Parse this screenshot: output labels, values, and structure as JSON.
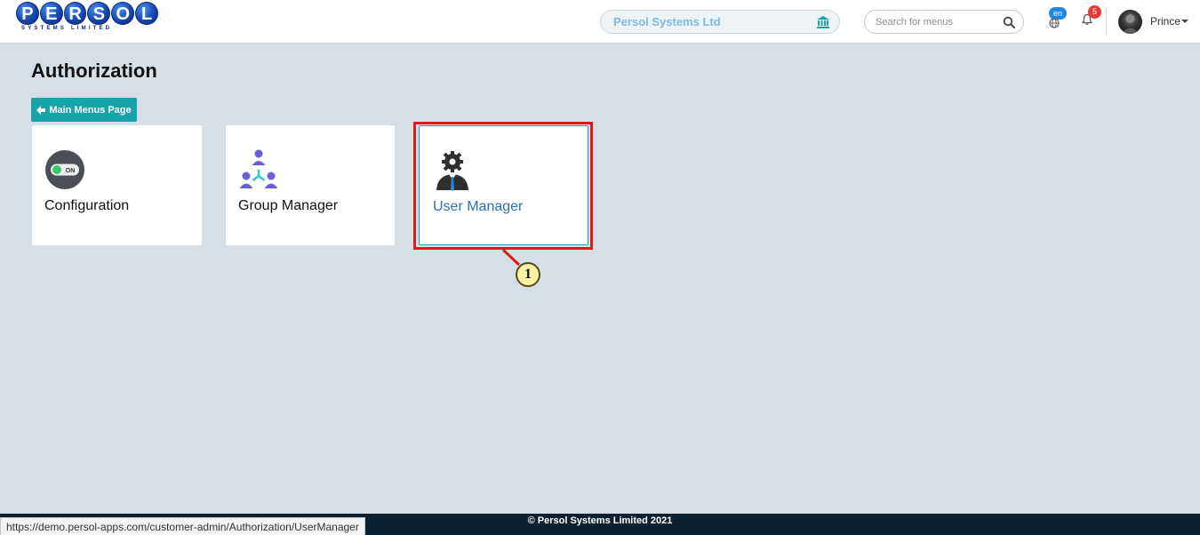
{
  "header": {
    "logo_letters": [
      "P",
      "E",
      "R",
      "S",
      "O",
      "L"
    ],
    "logo_subtitle": "SYSTEMS LIMITED",
    "company_name": "Persol Systems Ltd",
    "search_placeholder": "Search for menus",
    "language_badge": "en",
    "notification_count": "5",
    "user_name": "Prince"
  },
  "main": {
    "page_title": "Authorization",
    "back_button_label": "Main Menus Page",
    "cards": [
      {
        "label": "Configuration",
        "icon": "toggle-on-icon",
        "toggle_text": "ON"
      },
      {
        "label": "Group Manager",
        "icon": "group-hierarchy-icon"
      },
      {
        "label": "User Manager",
        "icon": "user-gear-icon"
      }
    ]
  },
  "annotation": {
    "marker_label": "1"
  },
  "footer": {
    "copyright": "© Persol Systems Limited 2021"
  },
  "status_bar": {
    "url": "https://demo.persol-apps.com/customer-admin/Authorization/UserManager"
  },
  "colors": {
    "accent": "#17a5a9",
    "link_blue": "#2a6fb5",
    "highlight": "#e01919",
    "footer_bg": "#0c2233",
    "page_bg": "#d6dee6"
  }
}
